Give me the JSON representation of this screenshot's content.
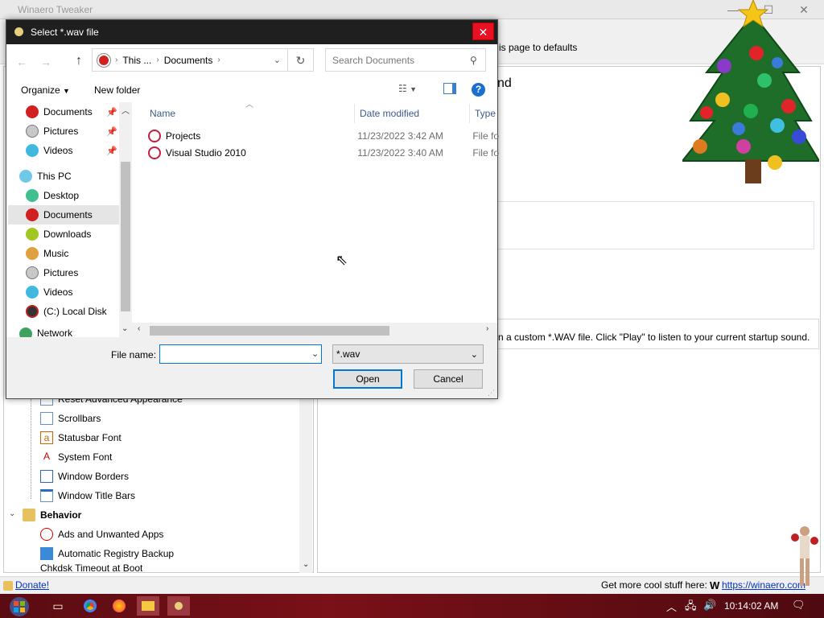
{
  "background_app": {
    "title": "Winaero Tweaker",
    "reset_label": "is page to defaults",
    "heading": "nd",
    "description": "n a custom *.WAV file. Click \"Play\" to listen to your current startup sound.",
    "tree_items": [
      "Reset Advanced Appearance",
      "Scrollbars",
      "Statusbar Font",
      "System Font",
      "Window Borders",
      "Window Title Bars"
    ],
    "behavior_label": "Behavior",
    "behavior_items": [
      "Ads and Unwanted Apps",
      "Automatic Registry Backup",
      "Chkdsk Timeout at Boot"
    ],
    "donate": "Donate!",
    "more_text": "Get more cool stuff here:",
    "link": "https://winaero.com"
  },
  "dialog": {
    "title": "Select *.wav file",
    "close": "✕",
    "breadcrumb": [
      "This ...",
      "Documents"
    ],
    "search_placeholder": "Search Documents",
    "organize": "Organize",
    "new_folder": "New folder",
    "nav_items": [
      {
        "label": "Documents",
        "icon": "documents-icon",
        "pinned": true
      },
      {
        "label": "Pictures",
        "icon": "pictures-icon",
        "pinned": true
      },
      {
        "label": "Videos",
        "icon": "videos-icon",
        "pinned": true
      },
      {
        "label": "This PC",
        "icon": "this-pc-icon"
      },
      {
        "label": "Desktop",
        "icon": "desktop-icon"
      },
      {
        "label": "Documents",
        "icon": "documents-icon",
        "selected": true
      },
      {
        "label": "Downloads",
        "icon": "downloads-icon"
      },
      {
        "label": "Music",
        "icon": "music-icon"
      },
      {
        "label": "Pictures",
        "icon": "pictures-icon"
      },
      {
        "label": "Videos",
        "icon": "videos-icon"
      },
      {
        "label": "(C:) Local Disk",
        "icon": "disk-icon"
      },
      {
        "label": "Network",
        "icon": "network-icon"
      }
    ],
    "columns": {
      "name": "Name",
      "date": "Date modified",
      "type": "Type"
    },
    "files": [
      {
        "name": "Projects",
        "date": "11/23/2022 3:42 AM",
        "type": "File fo"
      },
      {
        "name": "Visual Studio 2010",
        "date": "11/23/2022 3:40 AM",
        "type": "File fo"
      }
    ],
    "file_name_label": "File name:",
    "file_name_value": "",
    "filter": "*.wav",
    "open": "Open",
    "cancel": "Cancel"
  },
  "taskbar": {
    "clock": "10:14:02 AM"
  }
}
